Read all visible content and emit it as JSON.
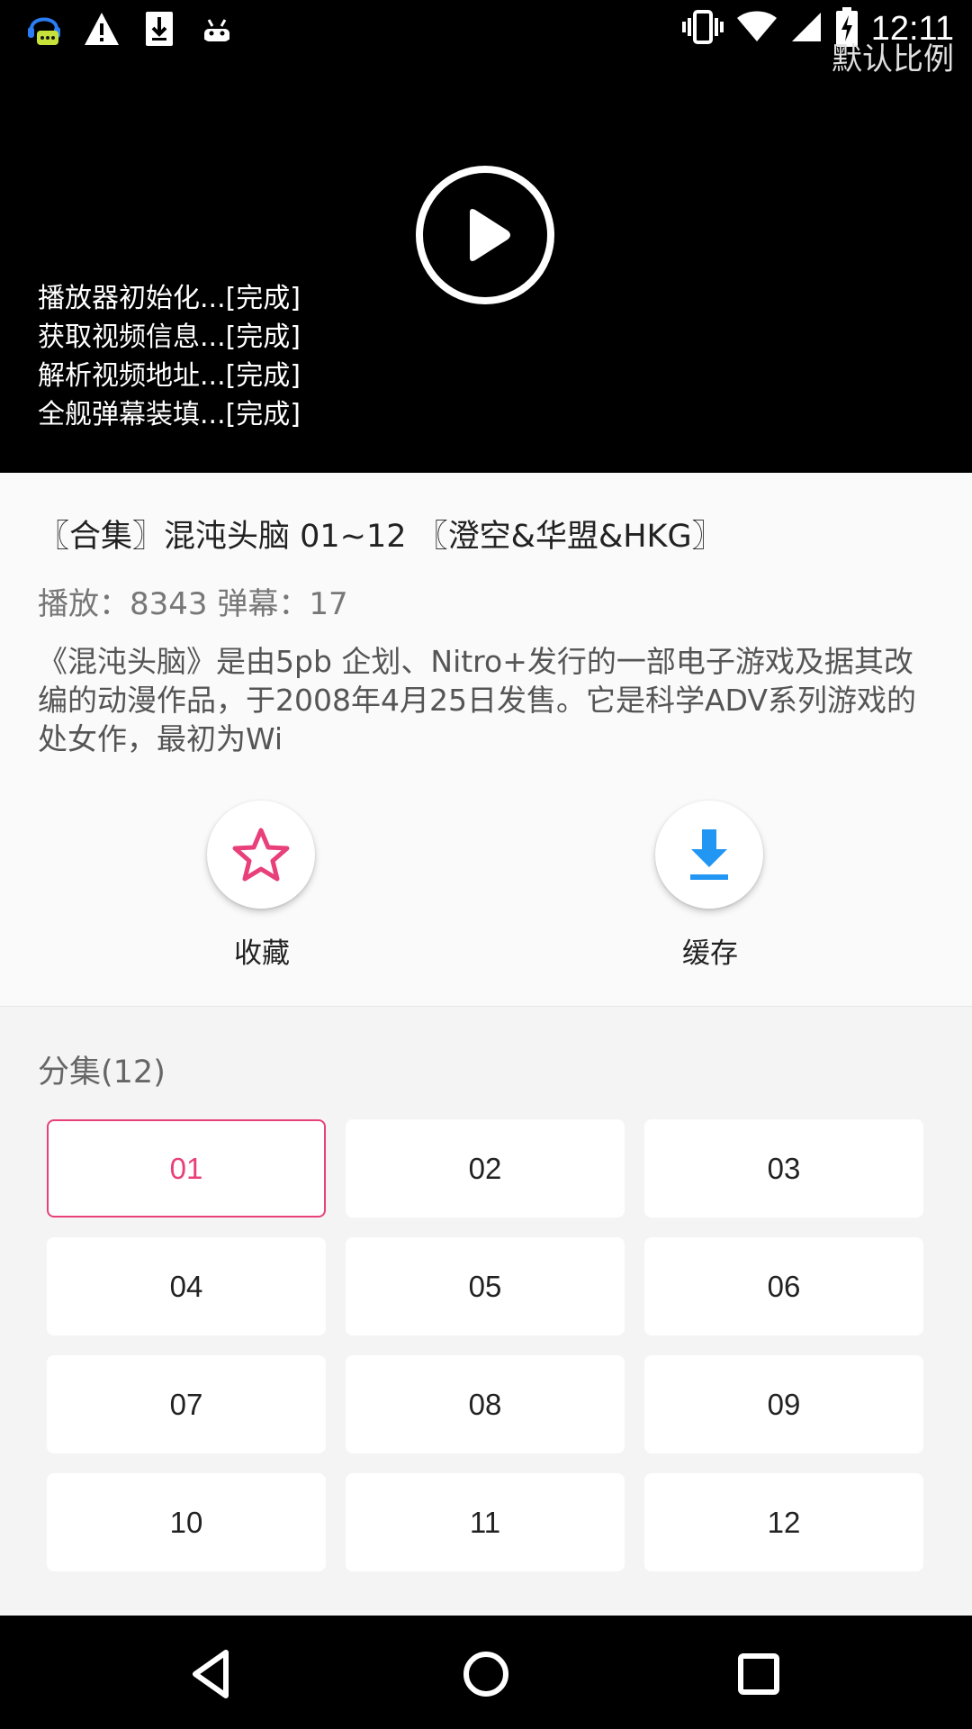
{
  "status_bar": {
    "time": "12:11",
    "left_icons": [
      "chat-bot-icon",
      "warning-icon",
      "download-icon",
      "android-icon"
    ],
    "right_icons": [
      "vibrate-icon",
      "wifi-icon",
      "signal-icon",
      "battery-charging-icon"
    ]
  },
  "player": {
    "aspect_ratio_label": "默认比例",
    "log_lines": [
      "播放器初始化...[完成]",
      "获取视频信息...[完成]",
      "解析视频地址...[完成]",
      "全舰弹幕装填...[完成]"
    ]
  },
  "video": {
    "title": "〖合集〗混沌头脑 01~12 〖澄空&华盟&HKG〗",
    "stats": "播放：8343  弹幕：17",
    "description": "《混沌头脑》是由5pb 企划、Nitro+发行的一部电子游戏及据其改编的动漫作品，于2008年4月25日发售。它是科学ADV系列游戏的处女作，最初为Wi"
  },
  "actions": {
    "favorite_label": "收藏",
    "cache_label": "缓存"
  },
  "episodes": {
    "heading": "分集(12)",
    "selected": "01",
    "items": [
      "01",
      "02",
      "03",
      "04",
      "05",
      "06",
      "07",
      "08",
      "09",
      "10",
      "11",
      "12"
    ]
  },
  "colors": {
    "accent_pink": "#e8407a",
    "accent_blue": "#2196f3",
    "player_bg": "#000000"
  }
}
